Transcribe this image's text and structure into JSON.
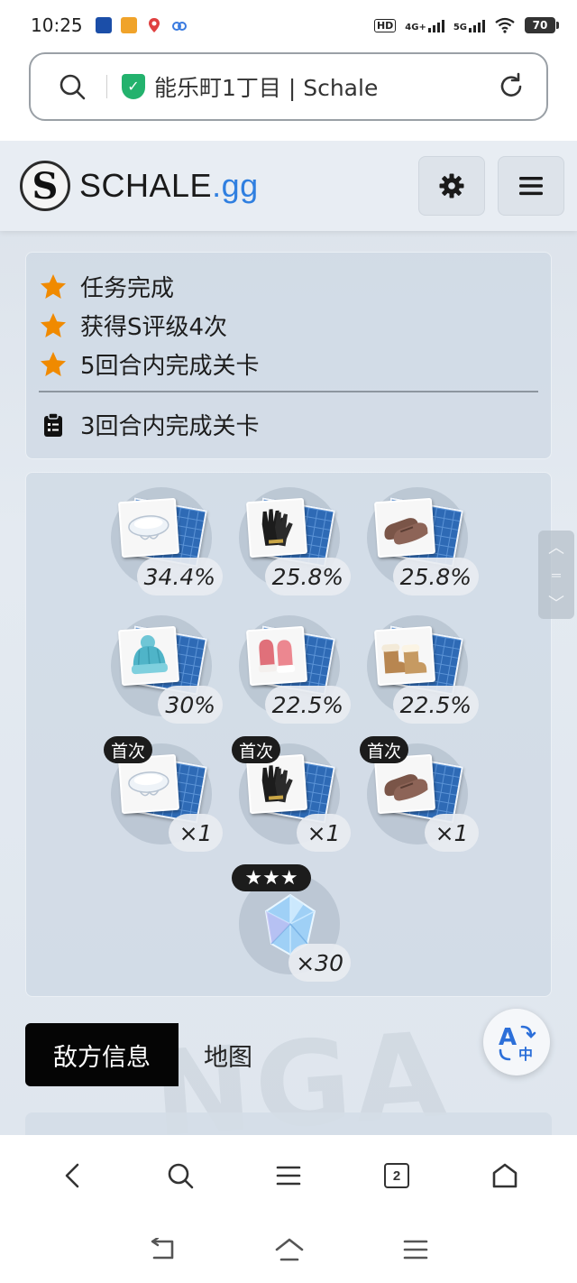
{
  "status_bar": {
    "time": "10:25",
    "battery": "70",
    "network_1": "4G+",
    "network_2": "5G",
    "hd": "HD"
  },
  "address_bar": {
    "url_text": "能乐町1丁目 | Schale"
  },
  "site_header": {
    "logo_mark": "S",
    "brand_main": "SCHALE",
    "brand_suffix": ".gg"
  },
  "missions": {
    "starred": [
      {
        "label": "任务完成"
      },
      {
        "label": "获得S评级4次"
      },
      {
        "label": "5回合内完成关卡"
      }
    ],
    "challenge": {
      "label": "3回合内完成关卡"
    },
    "star_color": "#f08a00"
  },
  "drops": [
    {
      "item": "wedding-veil",
      "value": "34.4%",
      "tag": ""
    },
    {
      "item": "black-gloves",
      "value": "25.8%",
      "tag": ""
    },
    {
      "item": "brown-loafers",
      "value": "25.8%",
      "tag": ""
    },
    {
      "item": "knit-beanie",
      "value": "30%",
      "tag": ""
    },
    {
      "item": "pink-mittens",
      "value": "22.5%",
      "tag": ""
    },
    {
      "item": "fur-boots",
      "value": "22.5%",
      "tag": ""
    },
    {
      "item": "wedding-veil",
      "value": "×1",
      "tag": "首次"
    },
    {
      "item": "black-gloves",
      "value": "×1",
      "tag": "首次"
    },
    {
      "item": "brown-loafers",
      "value": "×1",
      "tag": "首次"
    },
    {
      "item": "pyroxene-crystal",
      "value": "×30",
      "tag": "★★★"
    }
  ],
  "tabs": [
    {
      "label": "敌方信息",
      "active": true
    },
    {
      "label": "地图",
      "active": false
    }
  ],
  "tabs_count": "2",
  "watermark": "NGA"
}
